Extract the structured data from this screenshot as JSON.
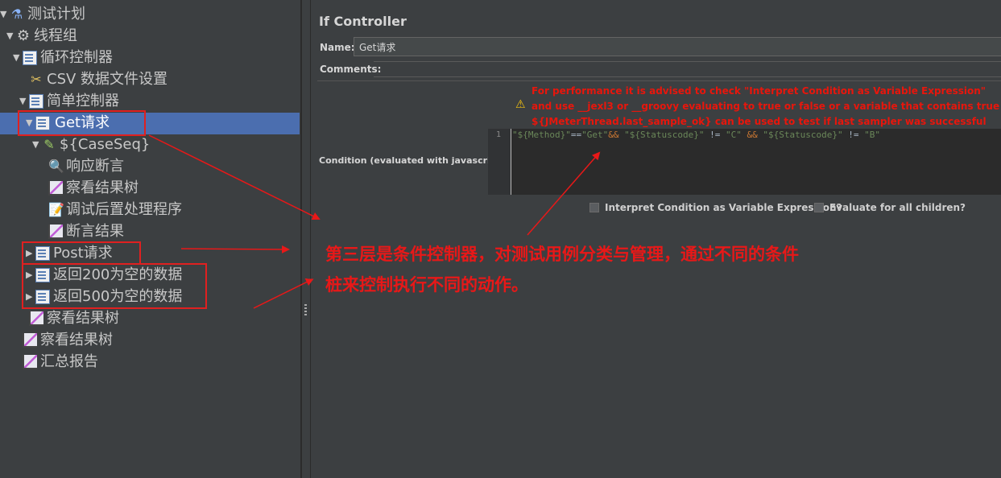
{
  "tree": {
    "items": [
      {
        "label": "测试计划"
      },
      {
        "label": "线程组"
      },
      {
        "label": "循环控制器"
      },
      {
        "label": "CSV 数据文件设置"
      },
      {
        "label": "简单控制器"
      },
      {
        "label": "Get请求"
      },
      {
        "label": "${CaseSeq}"
      },
      {
        "label": "响应断言"
      },
      {
        "label": "察看结果树"
      },
      {
        "label": "调试后置处理程序"
      },
      {
        "label": "断言结果"
      },
      {
        "label": "Post请求"
      },
      {
        "label": "返回200为空的数据"
      },
      {
        "label": "返回500为空的数据"
      },
      {
        "label": "察看结果树"
      },
      {
        "label": "察看结果树"
      },
      {
        "label": "汇总报告"
      }
    ]
  },
  "panel": {
    "title": "If Controller",
    "name_label": "Name:",
    "name_value": "Get请求",
    "comments_label": "Comments:",
    "warning_lines": [
      "For performance it is advised to check \"Interpret Condition as Variable Expression\"",
      "and use __jexl3 or __groovy evaluating to true or false or a variable that contains true or fal",
      "${JMeterThread.last_sample_ok} can be used to test if last sampler was successful"
    ],
    "condition_label": "Condition (evaluated with javascript)",
    "line_number": "1",
    "code": {
      "p1": "\"${Method}\"",
      "p2": "==",
      "p3": "\"Get\"",
      "p4": "&& ",
      "p5": "\"${Statuscode}\"",
      "p6": " != ",
      "p7": "\"C\"",
      "p8": " && ",
      "p9": "\"${Statuscode}\"",
      "p10": " != ",
      "p11": "\"B\""
    },
    "interpret_label": "Interpret Condition as Variable Expression?",
    "evaluate_label": "Evaluate for all children?"
  },
  "annotation": {
    "line1": "第三层是条件控制器，对测试用例分类与管理，通过不同的条件",
    "line2": "桩来控制执行不同的动作。"
  },
  "colors": {
    "background": "#3c3f41",
    "selection": "#4b6eaf",
    "annotation_red": "#e81818",
    "warning_red": "#e8160c"
  }
}
